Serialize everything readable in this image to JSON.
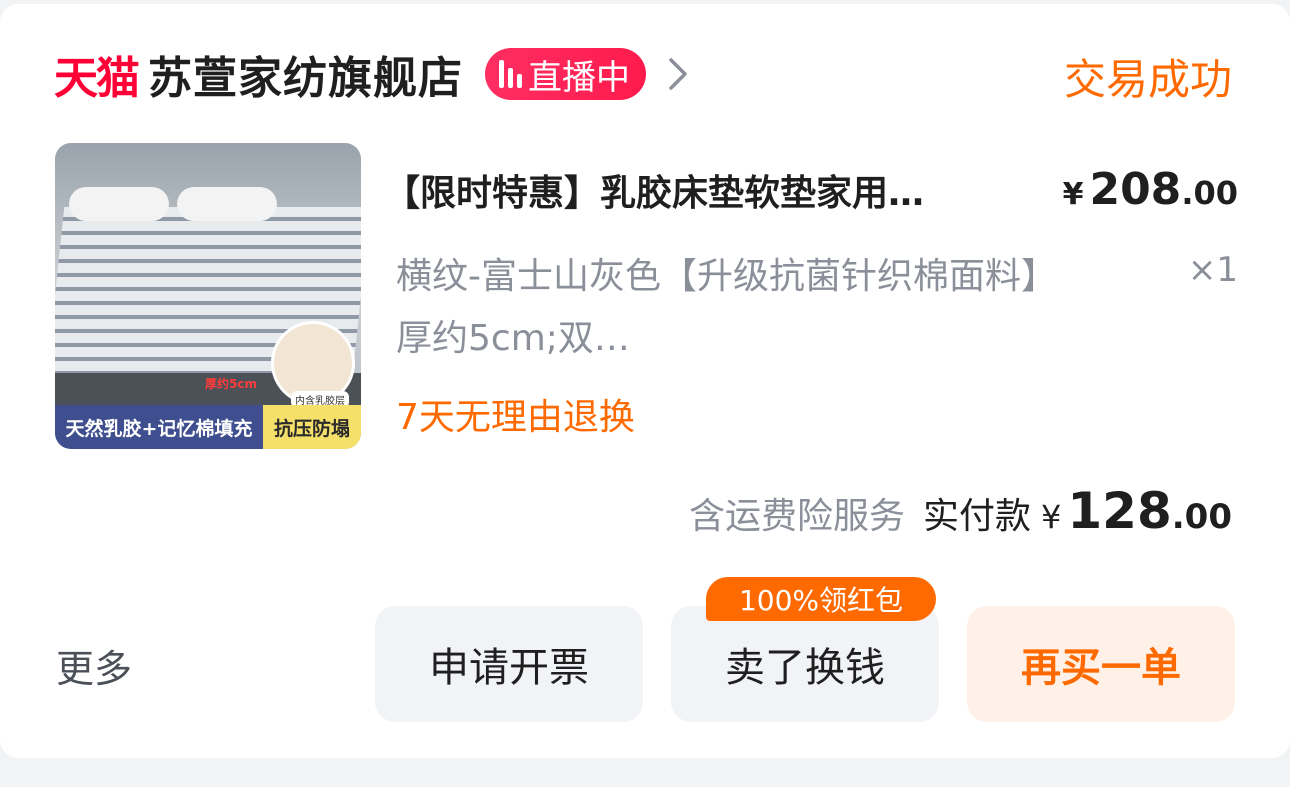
{
  "header": {
    "platform_logo": "天猫",
    "shop_name": "苏萱家纺旗舰店",
    "live_badge": "直播中",
    "order_status": "交易成功"
  },
  "product": {
    "image_tags": {
      "left": "天然乳胶+记忆棉填充",
      "right": "抗压防塌",
      "thickness": "厚约5cm",
      "inner_label": "内含乳胶层"
    },
    "title": "【限时特惠】乳胶床垫软垫家用…",
    "price": {
      "currency": "¥",
      "integer": "208",
      "decimal": ".00"
    },
    "variant": "横纹-富士山灰色【升级抗菌针织棉面料】厚约5cm;双…",
    "quantity": "×1",
    "return_policy": "7天无理由退换"
  },
  "payment": {
    "insurance_note": "含运费险服务",
    "paid_label": "实付款",
    "paid_amount": {
      "currency": "¥",
      "integer": "128",
      "decimal": ".00"
    }
  },
  "actions": {
    "more": "更多",
    "invoice": "申请开票",
    "resell": "卖了换钱",
    "resell_promo": "100%领红包",
    "buy_again": "再买一单"
  },
  "colors": {
    "brand": "#ff0036",
    "accent": "#ff6a00",
    "live": "#ff2e63"
  },
  "icons": [
    "live-bars-icon",
    "chevron-right-icon"
  ]
}
